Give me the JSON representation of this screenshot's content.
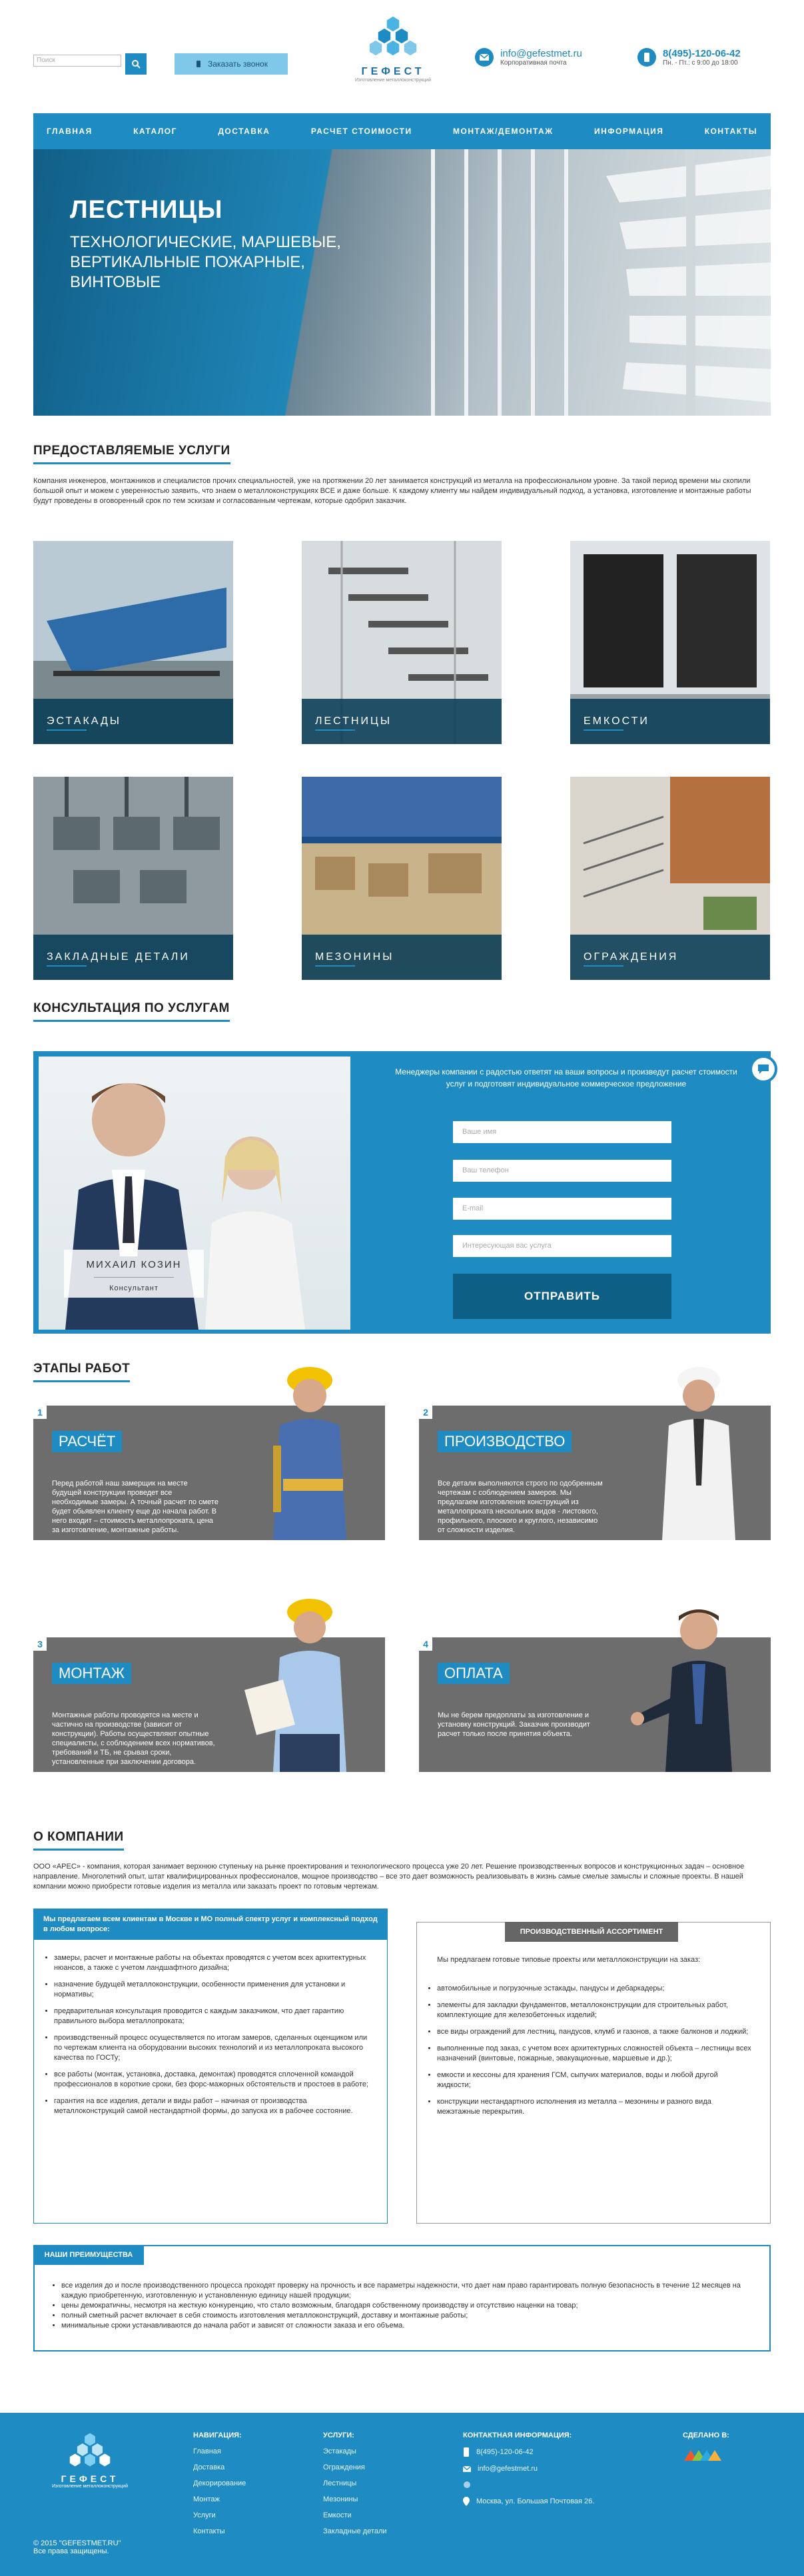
{
  "header": {
    "search_placeholder": "Поиск",
    "callback_label": "Заказать звонок",
    "logo_name": "ГЕФЕСТ",
    "logo_sub": "Изготовление металлоконструкций",
    "email": "info@gefestmet.ru",
    "email_sub": "Корпоративная почта",
    "phone": "8(495)-120-06-42",
    "phone_sub": "Пн. - Пт.: с 9:00 до 18:00"
  },
  "nav": [
    "Главная",
    "Каталог",
    "Доставка",
    "Расчет стоимости",
    "Монтаж/демонтаж",
    "Информация",
    "Контакты"
  ],
  "hero": {
    "title": "ЛЕСТНИЦЫ",
    "subtitle": "ТЕХНОЛОГИЧЕСКИЕ, МАРШЕВЫЕ, ВЕРТИКАЛЬНЫЕ ПОЖАРНЫЕ, ВИНТОВЫЕ"
  },
  "services": {
    "title": "Предоставляемые услуги",
    "text": "Компания инженеров, монтажников и специалистов прочих специальностей, уже на протяжении 20 лет занимается конструкций из металла на профессиональном уровне. За такой период времени мы скопили большой опыт и можем с уверенностью заявить, что знаем о металлоконструкциях ВСЕ и даже больше. К каждому клиенту мы найдем индивидуальный подход, а установка, изготовление и монтажные работы будут проведены в оговоренный срок по тем эскизам и согласованным чертежам, которые одобрил заказчик.",
    "items": [
      "Эстакады",
      "Лестницы",
      "Емкости",
      "Закладные детали",
      "Мезонины",
      "Ограждения"
    ]
  },
  "consult": {
    "title": "Консультация по услугам",
    "intro": "Менеджеры компании с радостью ответят на ваши вопросы и произведут расчет стоимости услуг и подготовят индивидуальное коммерческое предложение",
    "name": "МИХАИЛ КОЗИН",
    "role": "Консультант",
    "fields": [
      "Ваше имя",
      "Ваш телефон",
      "E-mail",
      "Интересующая вас услуга"
    ],
    "send_label": "Отправить"
  },
  "stages": {
    "title": "Этапы работ",
    "items": [
      {
        "num": "1",
        "title": "Расчёт",
        "text": "Перед работой наш замерщик на месте будущей конструкции проведет все необходимые замеры. А точный расчет по смете будет обьявлен клиенту еще до начала работ. В него входит – стоимость металлопроката, цена за изготовление, монтажные работы."
      },
      {
        "num": "2",
        "title": "Производство",
        "text": "Все детали выполняются строго по одобренным чертежам с соблюдением замеров. Мы предлагаем изготовление конструкций из металлопроката нескольких видов - листового, профильного, плоского и круглого, независимо от сложности изделия."
      },
      {
        "num": "3",
        "title": "Монтаж",
        "text": "Монтажные работы проводятся на месте и частично на производстве (зависит от конструкции). Работы осуществляют опытные специалисты, с соблюдением всех нормативов, требований и ТБ, не срывая сроки, установленные при заключении договора."
      },
      {
        "num": "4",
        "title": "Оплата",
        "text": "Мы не берем предоплаты за изготовление и установку конструкций. Заказчик производит расчет только после принятия объекта."
      }
    ]
  },
  "about": {
    "title": "О компании",
    "text": "ООО «АРЕС» - компания, которая занимает верхнюю ступеньку на рынке проектирования и технологического процесса уже 20 лет. Решение производственных вопросов и конструкционных задач – основное направление. Многолетний опыт, штат квалифицированных профессионалов, мощное производство – все это дает возможность реализовывать в жизнь самые смелые замыслы и сложные проекты. В нашей компании можно приобрести готовые изделия из металла или заказать проект по готовым чертежам.",
    "left_head": "Мы предлагаем всем клиентам в Москве и МО полный спектр услуг и комплексный подход в любом вопросе:",
    "left_items": [
      "замеры, расчет и монтажные работы на объектах проводятся с учетом всех архитектурных нюансов, а также с учетом ландшафтного дизайна;",
      "назначение будущей металлоконструкции, особенности применения для установки и нормативы;",
      "предварительная консультация проводится с каждым заказчиком, что дает гарантию правильного выбора металлопроката;",
      "производственный процесс осуществляется по итогам замеров, сделанных оценщиком или по чертежам клиента на оборудовании высоких технологий и из металлопроката высокого качества по ГОСТу;",
      "все работы (монтаж, установка, доставка, демонтаж) проводятся сплоченной командой профессионалов в короткие сроки, без форс-мажорных обстоятельств и простоев в работе;",
      "гарантия на все изделия, детали и виды работ – начиная от производства металлоконструкций самой нестандартной формы, до запуска их в рабочее состояние."
    ],
    "right_head": "Производственный ассортимент",
    "right_intro": "Мы предлагаем готовые типовые проекты или металлоконструкции на заказ:",
    "right_items": [
      "автомобильные и погрузочные эстакады, пандусы и дебаркадеры;",
      "элементы для закладки фундаментов, металлоконструкции для строительных работ, комплектующие для железобетонных изделий;",
      "все виды ограждений для лестниц, пандусов, клумб и газонов, а также балконов и лоджий;",
      "выполненные под заказ, с учетом всех архитектурных сложностей объекта – лестницы всех назначений (винтовые, пожарные, эвакуационные, маршевые и др.);",
      "емкости и кессоны для хранения ГСМ, сыпучих материалов, воды и любой другой жидкости;",
      "конструкции нестандартного исполнения из металла – мезонины и разного вида межэтажные перекрытия."
    ]
  },
  "advantages": {
    "title": "Наши преимущества",
    "items": [
      "все изделия до и после производственного процесса проходят проверку на прочность и все параметры надежности, что дает нам право гарантировать полную безопасность в течение 12 месяцев на каждую приобретенную, изготовленную и установленную единицу нашей продукции;",
      "цены демократичны, несмотря на жесткую конкуренцию, что стало возможным, благодаря собственному производству и отсутствию наценки на товар;",
      "полный сметный расчет включает в себя стоимость изготовления металлоконструкций, доставку и монтажные работы;",
      "минимальные сроки устанавливаются до начала работ и зависят от сложности заказа и его объема."
    ]
  },
  "footer": {
    "logo_name": "ГЕФЕСТ",
    "logo_sub": "Изготовление металлоконструкций",
    "copyright": "© 2015 \"GEFESTMET.RU\"",
    "rights": "Все права защищены.",
    "nav_title": "Навигация:",
    "nav_items": [
      "Главная",
      "Доставка",
      "Декорирование",
      "Монтаж",
      "Услуги",
      "Контакты"
    ],
    "svc_title": "Услуги:",
    "svc_items": [
      "Эстакады",
      "Ограждения",
      "Лестницы",
      "Мезонины",
      "Емкости",
      "Закладные детали"
    ],
    "contact_title": "Контактная информация:",
    "phone": "8(495)-120-06-42",
    "email": "info@gefestmet.ru",
    "address": "Москва, ул. Большая Почтовая 26.",
    "made_title": "Сделано в:"
  },
  "colors": {
    "accent": "#1e8bc3",
    "dark": "#0d5f86",
    "stage_bg": "#6d6d6d"
  }
}
